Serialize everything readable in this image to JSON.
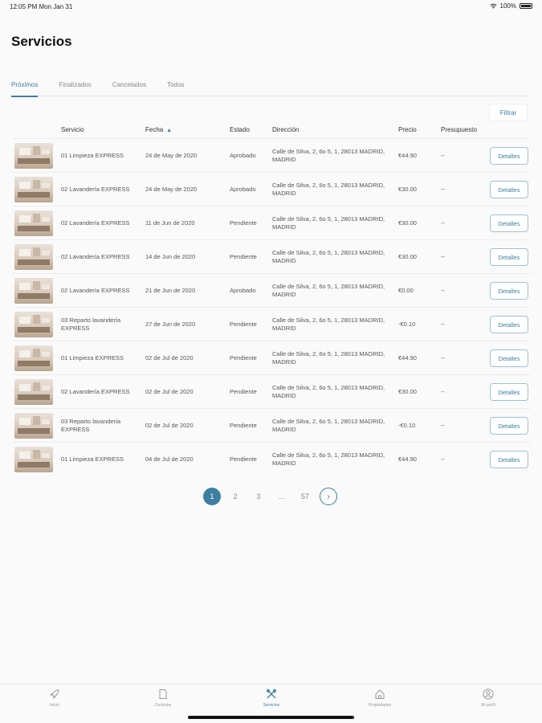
{
  "status_bar": {
    "time": "12:05 PM   Mon Jan 31",
    "battery": "100%"
  },
  "title": "Servicios",
  "tabs": [
    {
      "label": "Próximos",
      "active": true
    },
    {
      "label": "Finalizados",
      "active": false
    },
    {
      "label": "Cancelados",
      "active": false
    },
    {
      "label": "Todos",
      "active": false
    }
  ],
  "filter_label": "Filtrar",
  "table": {
    "headers": {
      "servicio": "Servicio",
      "fecha": "Fecha",
      "estado": "Estado",
      "direccion": "Dirección",
      "precio": "Precio",
      "presupuesto": "Presupuesto"
    },
    "details_label": "Detalles",
    "rows": [
      {
        "servicio": "01 Limpieza EXPRESS",
        "fecha": "24 de May de 2020",
        "estado": "Aprobado",
        "direccion": "Calle de Silva, 2, 6o 5, 1, 28013 MADRID, MADRID",
        "precio": "€44.90",
        "presupuesto": "--"
      },
      {
        "servicio": "02 Lavandería EXPRESS",
        "fecha": "24 de May de 2020",
        "estado": "Aprobado",
        "direccion": "Calle de Silva, 2, 6o 5, 1, 28013 MADRID, MADRID",
        "precio": "€30.00",
        "presupuesto": "--"
      },
      {
        "servicio": "02 Lavandería EXPRESS",
        "fecha": "11 de Jun de 2020",
        "estado": "Pendiente",
        "direccion": "Calle de Silva, 2, 6o 5, 1, 28013 MADRID, MADRID",
        "precio": "€30.00",
        "presupuesto": "--"
      },
      {
        "servicio": "02 Lavandería EXPRESS",
        "fecha": "14 de Jun de 2020",
        "estado": "Pendiente",
        "direccion": "Calle de Silva, 2, 6o 5, 1, 28013 MADRID, MADRID",
        "precio": "€30.00",
        "presupuesto": "--"
      },
      {
        "servicio": "02 Lavandería EXPRESS",
        "fecha": "21 de Jun de 2020",
        "estado": "Aprobado",
        "direccion": "Calle de Silva, 2, 6o 5, 1, 28013 MADRID, MADRID",
        "precio": "€0.00",
        "presupuesto": "--"
      },
      {
        "servicio": "03 Reparto lavandería EXPRESS",
        "fecha": "27 de Jun de 2020",
        "estado": "Pendiente",
        "direccion": "Calle de Silva, 2, 6o 5, 1, 28013 MADRID, MADRID",
        "precio": "-€0.10",
        "presupuesto": "--"
      },
      {
        "servicio": "01 Limpieza EXPRESS",
        "fecha": "02 de Jul de 2020",
        "estado": "Pendiente",
        "direccion": "Calle de Silva, 2, 6o 5, 1, 28013 MADRID, MADRID",
        "precio": "€44.90",
        "presupuesto": "--"
      },
      {
        "servicio": "02 Lavandería EXPRESS",
        "fecha": "02 de Jul de 2020",
        "estado": "Pendiente",
        "direccion": "Calle de Silva, 2, 6o 5, 1, 28013 MADRID, MADRID",
        "precio": "€30.00",
        "presupuesto": "--"
      },
      {
        "servicio": "03 Reparto lavandería EXPRESS",
        "fecha": "02 de Jul de 2020",
        "estado": "Pendiente",
        "direccion": "Calle de Silva, 2, 6o 5, 1, 28013 MADRID, MADRID",
        "precio": "-€0.10",
        "presupuesto": "--"
      },
      {
        "servicio": "01 Limpieza EXPRESS",
        "fecha": "04 de Jul de 2020",
        "estado": "Pendiente",
        "direccion": "Calle de Silva, 2, 6o 5, 1, 28013 MADRID, MADRID",
        "precio": "€44.90",
        "presupuesto": "--"
      }
    ]
  },
  "pagination": {
    "pages": [
      "1",
      "2",
      "3",
      "...",
      "57"
    ],
    "current": "1",
    "next_icon": "chevron-right-icon"
  },
  "tab_bar": [
    {
      "label": "Inicio",
      "icon": "rocket-icon",
      "active": false
    },
    {
      "label": "Contratar",
      "icon": "document-icon",
      "active": false
    },
    {
      "label": "Servicios",
      "icon": "tools-icon",
      "active": true
    },
    {
      "label": "Propiedades",
      "icon": "house-icon",
      "active": false
    },
    {
      "label": "Mi perfil",
      "icon": "user-icon",
      "active": false
    }
  ],
  "colors": {
    "accent": "#3e7fa0",
    "background": "#fafafa"
  }
}
